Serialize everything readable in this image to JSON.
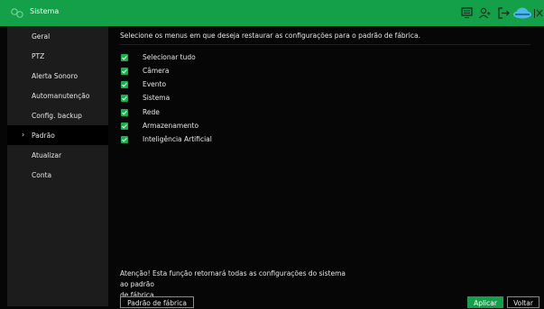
{
  "window": {
    "title": "Sistema"
  },
  "sidebar": {
    "items": [
      {
        "label": "Geral"
      },
      {
        "label": "PTZ"
      },
      {
        "label": "Alerta Sonoro"
      },
      {
        "label": "Automanutenção"
      },
      {
        "label": "Config. backup"
      },
      {
        "label": "Padrão",
        "active": true
      },
      {
        "label": "Atualizar"
      },
      {
        "label": "Conta"
      }
    ]
  },
  "main": {
    "instruction": "Selecione os menus em que deseja restaurar as configurações para o padrão de fábrica.",
    "options": [
      {
        "label": "Selecionar tudo",
        "checked": true
      },
      {
        "label": "Câmera",
        "checked": true
      },
      {
        "label": "Evento",
        "checked": true
      },
      {
        "label": "Sistema",
        "checked": true
      },
      {
        "label": "Rede",
        "checked": true
      },
      {
        "label": "Armazenamento",
        "checked": true
      },
      {
        "label": "Inteligência Artificial",
        "checked": true
      }
    ],
    "warning_line1": "Atenção! Esta função retornará todas as configurações do sistema ao padrão",
    "warning_line2": "de fábrica.",
    "factory_button": "Padrão de fábrica",
    "apply_button": "Aplicar",
    "back_button": "Voltar"
  },
  "colors": {
    "accent": "#13a049",
    "sidebar": "#1c1c1c",
    "background": "#060606"
  }
}
